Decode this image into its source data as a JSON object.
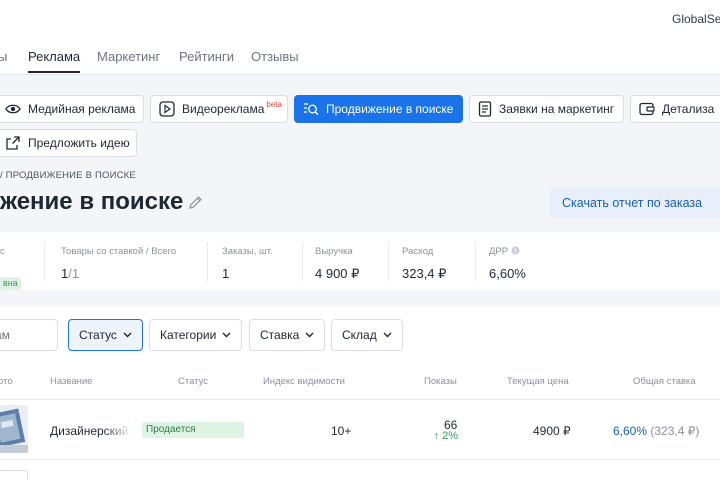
{
  "header": {
    "brand": "GlobalSe",
    "tabs": [
      {
        "label": "ы",
        "active": false
      },
      {
        "label": "Реклама",
        "active": true
      },
      {
        "label": "Маркетинг",
        "active": false
      },
      {
        "label": "Рейтинги",
        "active": false
      },
      {
        "label": "Отзывы",
        "active": false
      }
    ]
  },
  "toolbar": {
    "media": "Медийная реклама",
    "video": "Видеореклама",
    "video_badge": "beta",
    "promo": "Продвижение в поиске",
    "requests": "Заявки на маркетинг",
    "details": "Детализа",
    "idea": "Предложить идею"
  },
  "page": {
    "breadcrumb": "/ ПРОДВИЖЕНИЕ В ПОИСКЕ",
    "title": "жение в поиске",
    "report_button": "Скачать отчет по заказа"
  },
  "stats": {
    "status": {
      "label": "с",
      "badge": "вна"
    },
    "products": {
      "label": "Товары со ставкой / Всего",
      "value_main": "1",
      "value_sep": "/",
      "value_total": "1"
    },
    "orders": {
      "label": "Заказы, шт.",
      "value": "1"
    },
    "revenue": {
      "label": "Выручка",
      "value": "4 900 ₽"
    },
    "spend": {
      "label": "Расход",
      "value": "323,4 ₽"
    },
    "drr": {
      "label": "ДРР",
      "value": "6,60%"
    }
  },
  "filters": {
    "search_placeholder": "ам",
    "status": "Статус",
    "categories": "Категории",
    "bid": "Ставка",
    "warehouse": "Склад"
  },
  "table": {
    "columns": [
      "ото",
      "Название",
      "Статус",
      "Индекс видимости",
      "Показы",
      "Текущая цена",
      "Общая ставка"
    ],
    "rows": [
      {
        "name": "Дизайнерский",
        "status": "Продается",
        "visibility": "10+",
        "impressions": "66",
        "impressions_change": "↑ 2%",
        "price": "4900 ₽",
        "bid_pct": "6,60%",
        "bid_amount": "(323,4 ₽)"
      }
    ]
  },
  "colors": {
    "accent": "#1a73e8",
    "success_bg": "#dff3e4",
    "success_text": "#2f9e55",
    "background": "#f3f5f8"
  },
  "icons": [
    "eye-icon",
    "play-icon",
    "search-list-icon",
    "document-icon",
    "wallet-icon",
    "external-link-icon",
    "pencil-icon",
    "chevron-down-icon",
    "info-icon",
    "arrow-up-icon"
  ]
}
